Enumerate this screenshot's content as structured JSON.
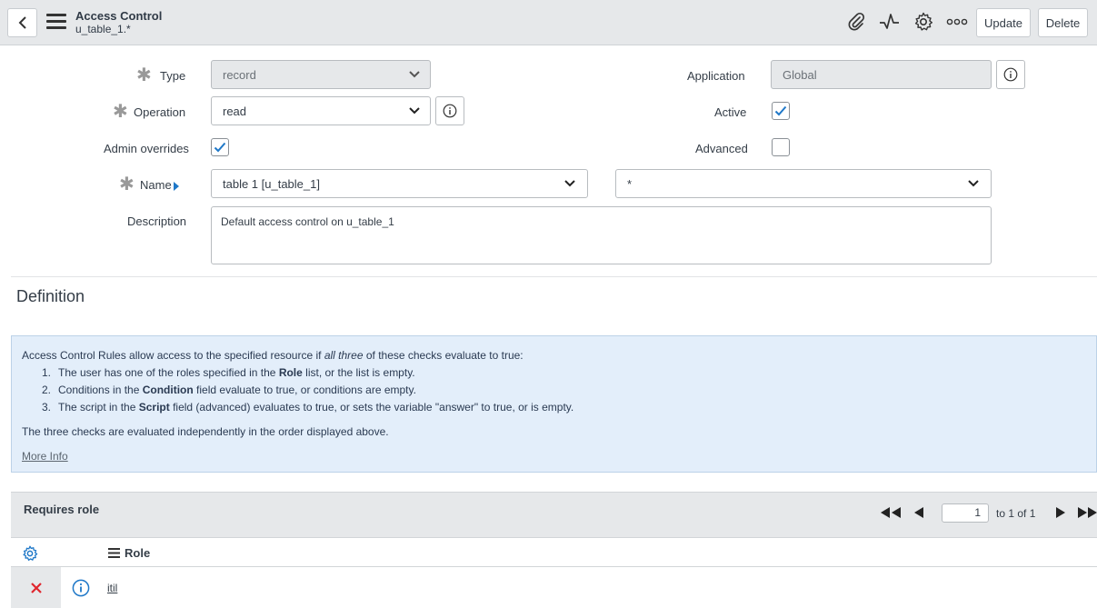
{
  "header": {
    "title": "Access Control",
    "subtitle": "u_table_1.*",
    "update_label": "Update",
    "delete_label": "Delete"
  },
  "form": {
    "type": {
      "label": "Type",
      "value": "record"
    },
    "operation": {
      "label": "Operation",
      "value": "read"
    },
    "admin_overrides": {
      "label": "Admin overrides",
      "checked": true
    },
    "name": {
      "label": "Name",
      "table_value": "table 1 [u_table_1]",
      "field_value": "*"
    },
    "description": {
      "label": "Description",
      "value": "Default access control on u_table_1"
    },
    "application": {
      "label": "Application",
      "value": "Global"
    },
    "active": {
      "label": "Active",
      "checked": true
    },
    "advanced": {
      "label": "Advanced",
      "checked": false
    }
  },
  "definition": {
    "title": "Definition",
    "intro_pre": "Access Control Rules allow access to the specified resource if ",
    "intro_em": "all three",
    "intro_post": " of these checks evaluate to true:",
    "items": [
      {
        "num": "1.",
        "pre": "The user has one of the roles specified in the ",
        "bold": "Role",
        "post": " list, or the list is empty."
      },
      {
        "num": "2.",
        "pre": "Conditions in the ",
        "bold": "Condition",
        "post": " field evaluate to true, or conditions are empty."
      },
      {
        "num": "3.",
        "pre": "The script in the ",
        "bold": "Script",
        "post": " field (advanced) evaluates to true, or sets the variable \"answer\" to true, or is empty."
      }
    ],
    "tail": "The three checks are evaluated independently in the order displayed above.",
    "more_info": "More Info"
  },
  "related_list": {
    "title": "Requires role",
    "page": "1",
    "page_text": "to 1 of 1",
    "column_role": "Role",
    "rows": [
      {
        "role": "itil"
      }
    ]
  },
  "colors": {
    "header_bg": "#e6e8ea",
    "check_blue": "#1f78c8",
    "info_bg": "#e3eefa",
    "delete_red": "#e0262e"
  }
}
